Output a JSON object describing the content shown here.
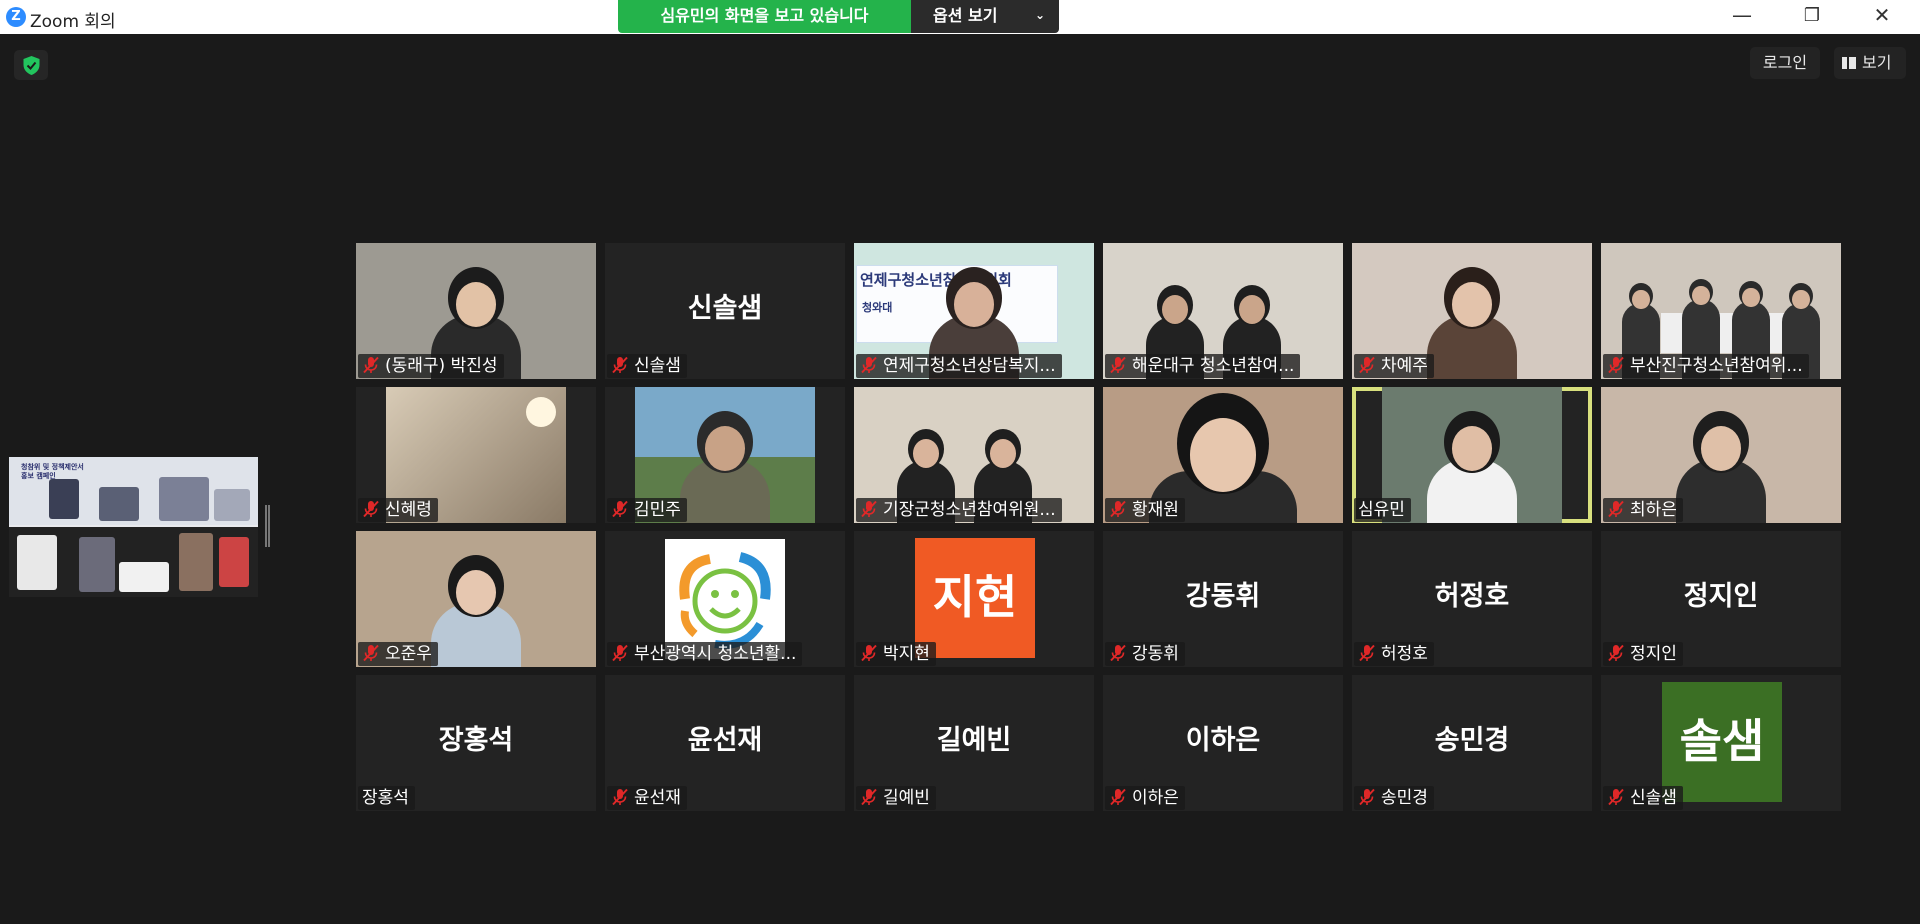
{
  "window": {
    "app_logo": "Z",
    "title": "Zoom 회의",
    "share_banner": "심유민의 화면을 보고 있습니다",
    "options_label": "옵션 보기",
    "controls": {
      "minimize": "—",
      "restore": "❐",
      "close": "✕"
    }
  },
  "toolbar": {
    "login_label": "로그인",
    "view_label": "보기"
  },
  "share_thumbnail": {
    "caption": "청참위 및 정책제안서\n홍보 캠페인"
  },
  "icons": {
    "mute": "muted-mic-icon",
    "shield": "security-shield-icon",
    "view": "view-layout-icon"
  },
  "colors": {
    "share_green": "#24b34b",
    "mute_red": "#e02828",
    "active_speaker": "#d8e07e"
  },
  "participants": [
    {
      "name": "(동래구) 박진성",
      "muted": true,
      "video": "camera"
    },
    {
      "name": "신솔샘",
      "muted": true,
      "video": "name",
      "display": "신솔샘"
    },
    {
      "name": "연제구청소년상담복지...",
      "muted": true,
      "video": "camera"
    },
    {
      "name": "해운대구 청소년참여...",
      "muted": true,
      "video": "camera"
    },
    {
      "name": "차예주",
      "muted": true,
      "video": "camera"
    },
    {
      "name": "부산진구청소년참여위...",
      "muted": true,
      "video": "camera"
    },
    {
      "name": "신혜령",
      "muted": true,
      "video": "camera"
    },
    {
      "name": "김민주",
      "muted": true,
      "video": "camera"
    },
    {
      "name": "기장군청소년참여위원...",
      "muted": true,
      "video": "camera"
    },
    {
      "name": "황재원",
      "muted": true,
      "video": "camera"
    },
    {
      "name": "심유민",
      "muted": false,
      "video": "camera",
      "active": true
    },
    {
      "name": "최하은",
      "muted": true,
      "video": "camera"
    },
    {
      "name": "오준우",
      "muted": true,
      "video": "camera"
    },
    {
      "name": "부산광역시 청소년활...",
      "muted": true,
      "video": "logo"
    },
    {
      "name": "박지현",
      "muted": true,
      "video": "avatar",
      "avatar_text": "지현",
      "avatar_color": "#f05a24"
    },
    {
      "name": "강동휘",
      "muted": true,
      "video": "name",
      "display": "강동휘"
    },
    {
      "name": "허정호",
      "muted": true,
      "video": "name",
      "display": "허정호"
    },
    {
      "name": "정지인",
      "muted": true,
      "video": "name",
      "display": "정지인"
    },
    {
      "name": "장홍석",
      "muted": false,
      "video": "name",
      "display": "장홍석"
    },
    {
      "name": "윤선재",
      "muted": true,
      "video": "name",
      "display": "윤선재"
    },
    {
      "name": "길예빈",
      "muted": true,
      "video": "name",
      "display": "길예빈"
    },
    {
      "name": "이하은",
      "muted": true,
      "video": "name",
      "display": "이하은"
    },
    {
      "name": "송민경",
      "muted": true,
      "video": "name",
      "display": "송민경"
    },
    {
      "name": "신솔샘",
      "muted": true,
      "video": "avatar",
      "avatar_text": "솔샘",
      "avatar_color": "#3b6f24"
    }
  ],
  "tile_texts": {
    "banner_tile3": "연제구청소년참여위원회",
    "banner_tile3_sub": "청와대"
  }
}
